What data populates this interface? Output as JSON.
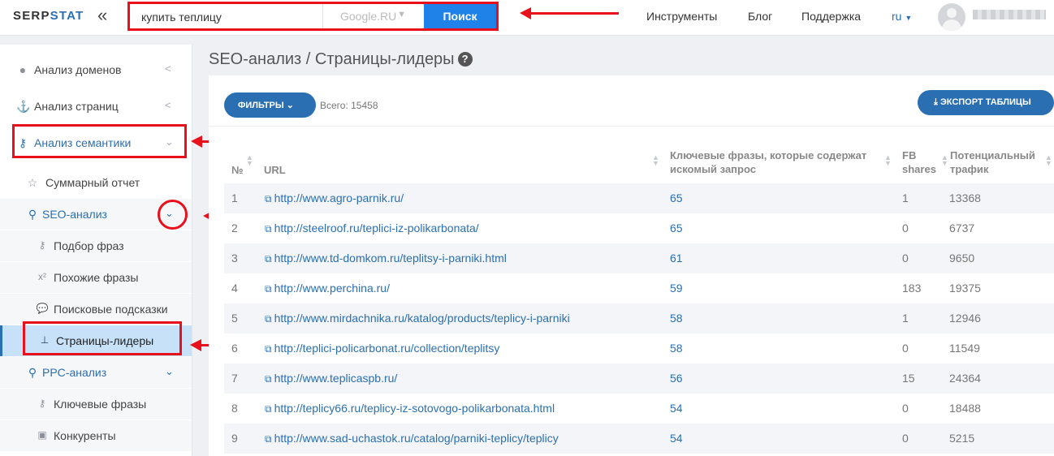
{
  "header": {
    "logo_main": "SERP",
    "logo_accent": "STAT",
    "collapse_icon": "«",
    "search_query": "купить теплицу",
    "search_engine": "Google.RU",
    "search_button": "Поиск",
    "nav": [
      "Инструменты",
      "Блог",
      "Поддержка"
    ],
    "lang": "ru"
  },
  "sidebar": {
    "items": [
      {
        "label": "Анализ доменов",
        "icon": "globe-icon"
      },
      {
        "label": "Анализ страниц",
        "icon": "anchor-icon"
      },
      {
        "label": "Анализ семантики",
        "icon": "key-icon"
      },
      {
        "label": "Суммарный отчет",
        "icon": "star-icon"
      },
      {
        "label": "SEO-анализ",
        "icon": "search-icon"
      },
      {
        "label": "Подбор фраз",
        "icon": "key-icon"
      },
      {
        "label": "Похожие фразы",
        "icon": "superscript-icon"
      },
      {
        "label": "Поисковые подсказки",
        "icon": "comment-icon"
      },
      {
        "label": "Страницы-лидеры",
        "icon": "sitemap-icon"
      },
      {
        "label": "PPC-анализ",
        "icon": "search-icon"
      },
      {
        "label": "Ключевые фразы",
        "icon": "key-icon"
      },
      {
        "label": "Конкуренты",
        "icon": "money-icon"
      }
    ]
  },
  "page": {
    "title": "SEO-анализ / Страницы-лидеры",
    "filters_button": "ФИЛЬТРЫ",
    "total": "Всего: 15458",
    "export_button": "ЭКСПОРТ ТАБЛИЦЫ"
  },
  "table": {
    "columns": [
      "№",
      "URL",
      "Ключевые фразы, которые содержат искомый запрос",
      "FB shares",
      "Потенциальный трафик"
    ],
    "column_lines": {
      "kw": [
        "Ключевые фразы, которые содержат",
        "искомый запрос"
      ],
      "fb": [
        "FB",
        "shares"
      ],
      "traffic": [
        "Потенциальный",
        "трафик"
      ]
    },
    "rows": [
      {
        "n": "1",
        "url": "http://www.agro-parnik.ru/",
        "kw": "65",
        "fb": "1",
        "traffic": "13368"
      },
      {
        "n": "2",
        "url": "http://steelroof.ru/teplici-iz-polikarbonata/",
        "kw": "65",
        "fb": "0",
        "traffic": "6737"
      },
      {
        "n": "3",
        "url": "http://www.td-domkom.ru/teplitsy-i-parniki.html",
        "kw": "61",
        "fb": "0",
        "traffic": "9650"
      },
      {
        "n": "4",
        "url": "http://www.perchina.ru/",
        "kw": "59",
        "fb": "183",
        "traffic": "19375"
      },
      {
        "n": "5",
        "url": "http://www.mirdachnika.ru/katalog/products/teplicy-i-parniki",
        "kw": "58",
        "fb": "1",
        "traffic": "12946"
      },
      {
        "n": "6",
        "url": "http://teplici-policarbonat.ru/collection/teplitsy",
        "kw": "58",
        "fb": "0",
        "traffic": "11549"
      },
      {
        "n": "7",
        "url": "http://www.teplicaspb.ru/",
        "kw": "56",
        "fb": "15",
        "traffic": "24364"
      },
      {
        "n": "8",
        "url": "http://teplicy66.ru/teplicy-iz-sotovogo-polikarbonata.html",
        "kw": "54",
        "fb": "0",
        "traffic": "18488"
      },
      {
        "n": "9",
        "url": "http://www.sad-uchastok.ru/catalog/parniki-teplicy/teplicy",
        "kw": "54",
        "fb": "0",
        "traffic": "5215"
      }
    ]
  },
  "colors": {
    "accent": "#2a6fb2",
    "annotation": "#e8101b",
    "active_bg": "#c6e1f8"
  }
}
